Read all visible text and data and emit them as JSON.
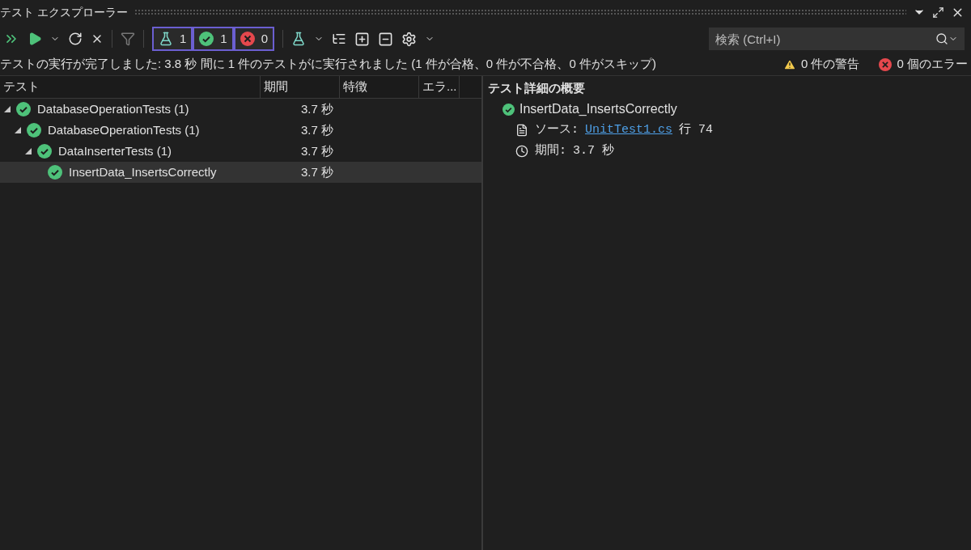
{
  "window": {
    "title": "テスト エクスプローラー"
  },
  "counters": [
    {
      "kind": "total",
      "count": "1"
    },
    {
      "kind": "passed",
      "count": "1"
    },
    {
      "kind": "failed",
      "count": "0"
    }
  ],
  "search": {
    "placeholder": "検索 (Ctrl+I)"
  },
  "status": {
    "summary": "テストの実行が完了しました: 3.8 秒 間に 1 件のテストがに実行されました (1 件が合格、0 件が不合格、0 件がスキップ)",
    "warnings": "0 件の警告",
    "errors": "0 個のエラー"
  },
  "table": {
    "columns": [
      "テスト",
      "期間",
      "特徴",
      "エラ..."
    ],
    "rows": [
      {
        "name": "DatabaseOperationTests (1)",
        "duration": "3.7 秒",
        "expanded": true,
        "selected": false,
        "children": [
          {
            "name": "DatabaseOperationTests (1)",
            "duration": "3.7 秒",
            "expanded": true,
            "selected": false,
            "children": [
              {
                "name": "DataInserterTests (1)",
                "duration": "3.7 秒",
                "expanded": true,
                "selected": false,
                "children": [
                  {
                    "name": "InsertData_InsertsCorrectly",
                    "duration": "3.7 秒",
                    "selected": true
                  }
                ]
              }
            ]
          }
        ]
      }
    ]
  },
  "details": {
    "heading": "テスト詳細の概要",
    "test_name": "InsertData_InsertsCorrectly",
    "source_label": "ソース:",
    "source_link": "UnitTest1.cs",
    "line": "行 74",
    "duration_label": "期間:",
    "duration": "3.7 秒"
  }
}
